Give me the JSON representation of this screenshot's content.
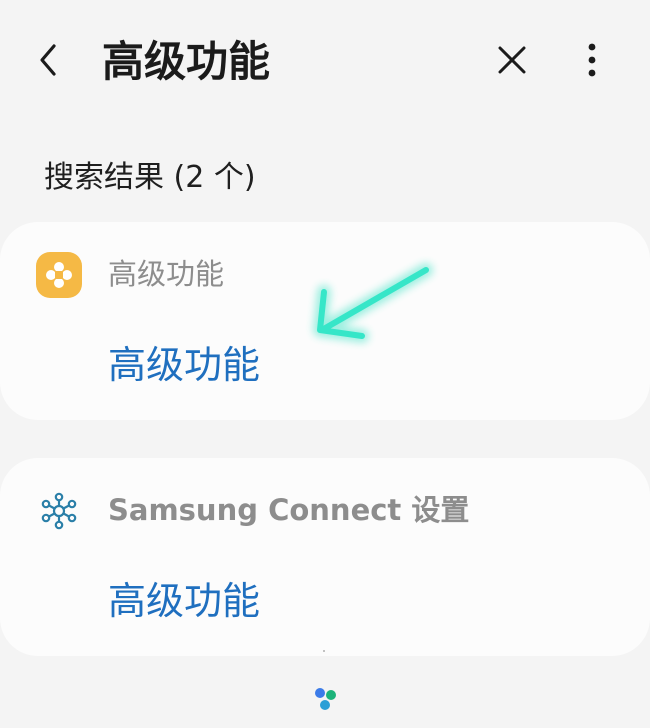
{
  "header": {
    "title": "高级功能",
    "icons": {
      "back": "chevron-left-icon",
      "close": "close-icon",
      "more": "more-vertical-icon"
    }
  },
  "results": {
    "label": "搜索结果 (2 个)"
  },
  "cards": [
    {
      "category": "高级功能",
      "result": "高级功能",
      "icon": "advanced-features-icon",
      "icon_color": "#f5b945"
    },
    {
      "category": "Samsung Connect 设置",
      "result": "高级功能",
      "icon": "connected-devices-icon",
      "icon_color": "#2a7fa8"
    }
  ],
  "colors": {
    "background": "#f4f4f4",
    "card": "#fcfcfc",
    "link": "#1f6fbf",
    "annotation_arrow": "#2fe0c0"
  }
}
